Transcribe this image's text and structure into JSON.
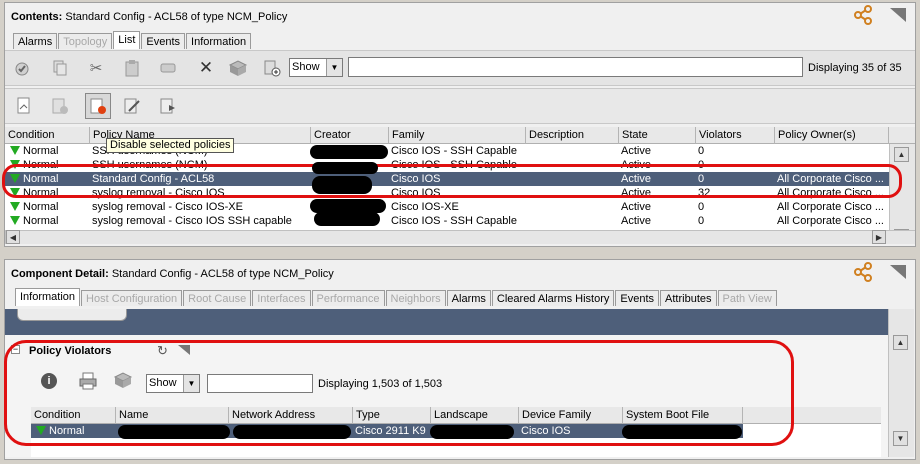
{
  "contents": {
    "title_prefix": "Contents:",
    "title": "Standard Config - ACL58 of type NCM_Policy",
    "tabs": [
      {
        "label": "Alarms",
        "disabled": false
      },
      {
        "label": "Topology",
        "disabled": true
      },
      {
        "label": "List",
        "disabled": false,
        "active": true
      },
      {
        "label": "Events",
        "disabled": false
      },
      {
        "label": "Information",
        "disabled": false
      }
    ],
    "show_select": "Show",
    "displaying": "Displaying 35 of 35",
    "tooltip": "Disable selected policies",
    "columns": [
      "Condition",
      "Policy Name",
      "Creator",
      "Family",
      "Description",
      "State",
      "Violators",
      "Policy Owner(s)"
    ],
    "rows": [
      {
        "condition": "Normal",
        "policy": "SSH usernames (NCM)",
        "family": "Cisco IOS - SSH Capable",
        "description": "",
        "state": "Active",
        "violators": "0",
        "owner": ""
      },
      {
        "condition": "Normal",
        "policy": "SSH usernames (NCM)",
        "family": "Cisco IOS - SSH Capable",
        "description": "",
        "state": "Active",
        "violators": "0",
        "owner": ""
      },
      {
        "condition": "Normal",
        "policy": "Standard Config - ACL58",
        "family": "Cisco IOS",
        "description": "",
        "state": "Active",
        "violators": "0",
        "owner": "All Corporate Cisco ..."
      },
      {
        "condition": "Normal",
        "policy": "syslog removal - Cisco IOS",
        "family": "Cisco IOS",
        "description": "",
        "state": "Active",
        "violators": "32",
        "owner": "All Corporate Cisco ..."
      },
      {
        "condition": "Normal",
        "policy": "syslog removal - Cisco IOS-XE",
        "family": "Cisco IOS-XE",
        "description": "",
        "state": "Active",
        "violators": "0",
        "owner": "All Corporate Cisco ..."
      },
      {
        "condition": "Normal",
        "policy": "syslog removal - Cisco IOS SSH capable",
        "family": "Cisco IOS - SSH Capable",
        "description": "",
        "state": "Active",
        "violators": "0",
        "owner": "All Corporate Cisco ..."
      }
    ]
  },
  "detail": {
    "title_prefix": "Component Detail:",
    "title": "Standard Config - ACL58 of type NCM_Policy",
    "tabs": [
      {
        "label": "Information",
        "disabled": false,
        "active": true
      },
      {
        "label": "Host Configuration",
        "disabled": true
      },
      {
        "label": "Root Cause",
        "disabled": true
      },
      {
        "label": "Interfaces",
        "disabled": true
      },
      {
        "label": "Performance",
        "disabled": true
      },
      {
        "label": "Neighbors",
        "disabled": true
      },
      {
        "label": "Alarms",
        "disabled": false
      },
      {
        "label": "Cleared Alarms History",
        "disabled": false
      },
      {
        "label": "Events",
        "disabled": false
      },
      {
        "label": "Attributes",
        "disabled": false
      },
      {
        "label": "Path View",
        "disabled": true
      }
    ],
    "section_title": "Policy Violators",
    "show_select": "Show",
    "displaying": "Displaying 1,503 of 1,503",
    "columns": [
      "Condition",
      "Name",
      "Network Address",
      "Type",
      "Landscape",
      "Device Family",
      "System Boot File"
    ],
    "rows": [
      {
        "condition": "Normal",
        "type": "Cisco 2911 K9",
        "family": "Cisco IOS"
      }
    ]
  },
  "colors": {
    "selected_row": "#4e5f7a",
    "highlight": "#e01010",
    "normal_icon": "#22aa22"
  }
}
